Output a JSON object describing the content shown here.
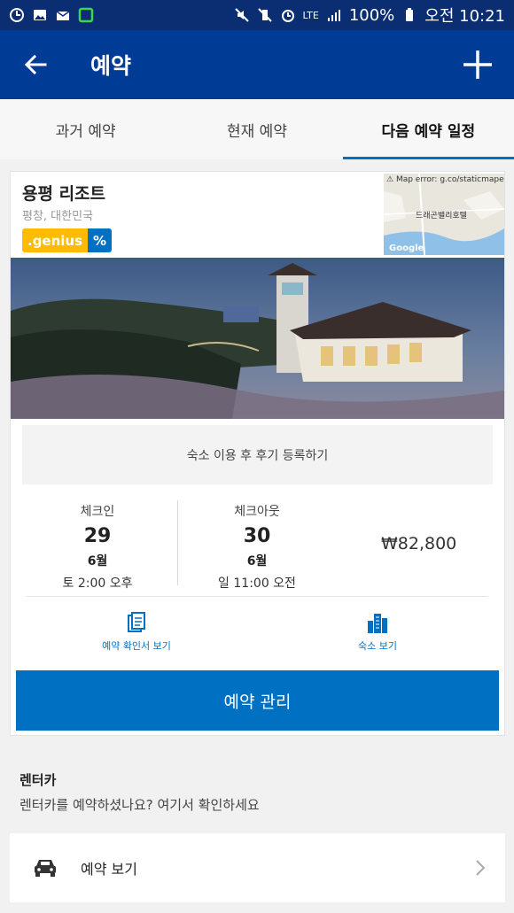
{
  "status_bar": {
    "battery": "100%",
    "time": "오전 10:21",
    "network": "LTE"
  },
  "app_bar": {
    "title": "예약",
    "back_icon": "arrow-left-icon",
    "add_icon": "plus-icon"
  },
  "tabs": [
    {
      "label": "과거 예약",
      "active": false
    },
    {
      "label": "현재 예약",
      "active": false
    },
    {
      "label": "다음 예약 일정",
      "active": true
    }
  ],
  "booking": {
    "hotel_name": "용평 리조트",
    "location": "평창, 대한민국",
    "genius_label": ".genius",
    "genius_badge": "%",
    "map": {
      "error_text": "Map error: g.co/staticmaperror",
      "label": "드래곤밸리호텔",
      "provider": "Google"
    },
    "review_prompt": "숙소 이용 후 후기 등록하기",
    "checkin": {
      "label": "체크인",
      "day": "29",
      "month": "6월",
      "time": "토 2:00 오후"
    },
    "checkout": {
      "label": "체크아웃",
      "day": "30",
      "month": "6월",
      "time": "일 11:00 오전"
    },
    "price": "₩82,800",
    "actions": [
      {
        "label": "예약 확인서 보기",
        "icon": "document-icon"
      },
      {
        "label": "숙소 보기",
        "icon": "building-icon"
      }
    ],
    "manage_label": "예약 관리"
  },
  "rental_car": {
    "title": "렌터카",
    "subtitle": "렌터카를 예약하셨나요? 여기서 확인하세요",
    "view_label": "예약 보기"
  },
  "colors": {
    "status_bar": "#0b2e72",
    "app_bar": "#003b95",
    "accent": "#0071c2",
    "genius_yellow": "#febb02"
  }
}
